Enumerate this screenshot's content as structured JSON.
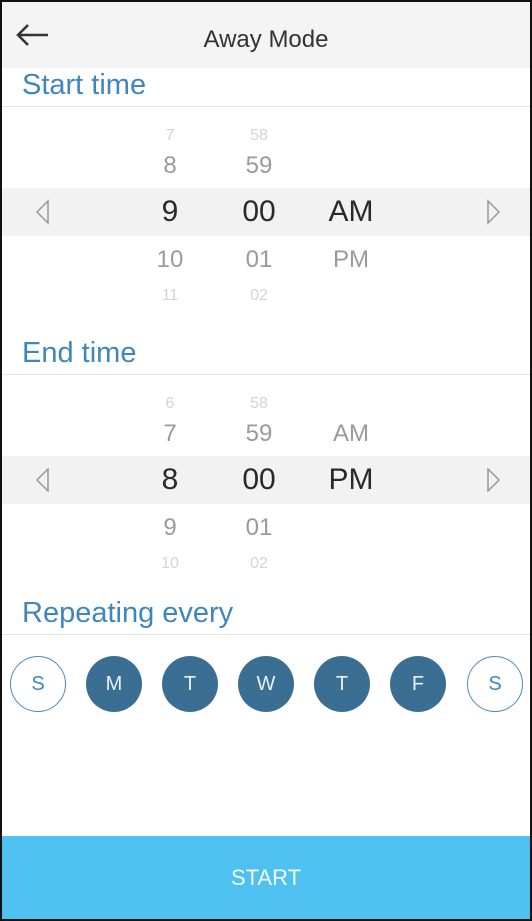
{
  "header": {
    "title": "Away Mode",
    "back_icon": "arrow-left-icon"
  },
  "start_time": {
    "label": "Start time",
    "rows": [
      {
        "hour": "7",
        "minute": "58",
        "period": ""
      },
      {
        "hour": "8",
        "minute": "59",
        "period": ""
      },
      {
        "hour": "9",
        "minute": "00",
        "period": "AM"
      },
      {
        "hour": "10",
        "minute": "01",
        "period": "PM"
      },
      {
        "hour": "11",
        "minute": "02",
        "period": ""
      }
    ]
  },
  "end_time": {
    "label": "End time",
    "rows": [
      {
        "hour": "6",
        "minute": "58",
        "period": ""
      },
      {
        "hour": "7",
        "minute": "59",
        "period": "AM"
      },
      {
        "hour": "8",
        "minute": "00",
        "period": "PM"
      },
      {
        "hour": "9",
        "minute": "01",
        "period": ""
      },
      {
        "hour": "10",
        "minute": "02",
        "period": ""
      }
    ]
  },
  "repeating": {
    "label": "Repeating every",
    "days": [
      {
        "letter": "S",
        "selected": false
      },
      {
        "letter": "M",
        "selected": true
      },
      {
        "letter": "T",
        "selected": true
      },
      {
        "letter": "W",
        "selected": true
      },
      {
        "letter": "T",
        "selected": true
      },
      {
        "letter": "F",
        "selected": true
      },
      {
        "letter": "S",
        "selected": false
      }
    ]
  },
  "footer": {
    "start_label": "START"
  },
  "colors": {
    "accent_text": "#3f86bd",
    "day_selected": "#3b6e93",
    "start_button": "#4ec1f0"
  }
}
